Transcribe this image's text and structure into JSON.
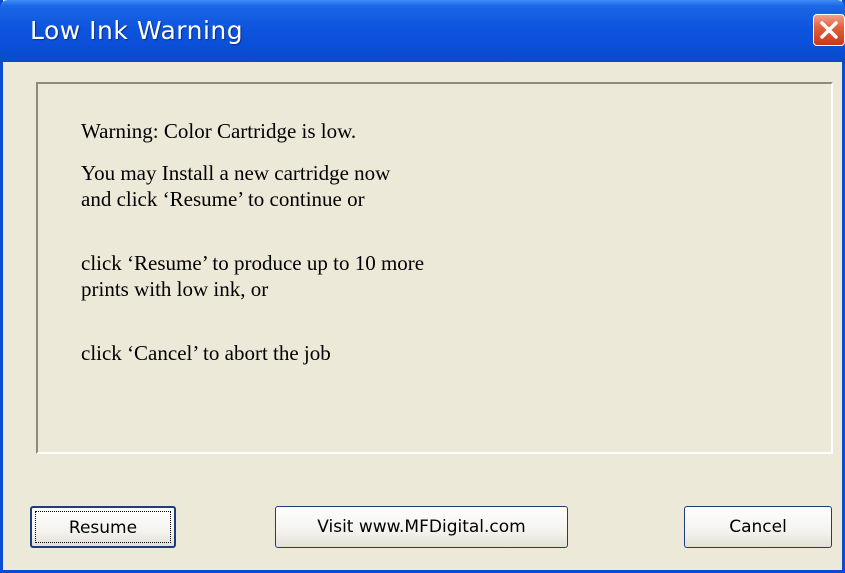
{
  "window": {
    "title": "Low Ink Warning"
  },
  "message": {
    "headline": "Warning: Color Cartridge is low.",
    "paragraph1_line1": "You may Install a new cartridge now",
    "paragraph1_line2": "and click ‘Resume’ to continue or",
    "paragraph2_line1": "click ‘Resume’ to produce up to 10 more",
    "paragraph2_line2": "prints with low ink, or",
    "paragraph3_line1": "click ‘Cancel’ to abort the job"
  },
  "buttons": {
    "resume": "Resume",
    "visit": "Visit www.MFDigital.com",
    "cancel": "Cancel"
  },
  "icons": {
    "close": "close-icon"
  },
  "colors": {
    "titlebar": "#0a4fd8",
    "close_button": "#e2613c",
    "dialog_background": "#ece9d8"
  }
}
